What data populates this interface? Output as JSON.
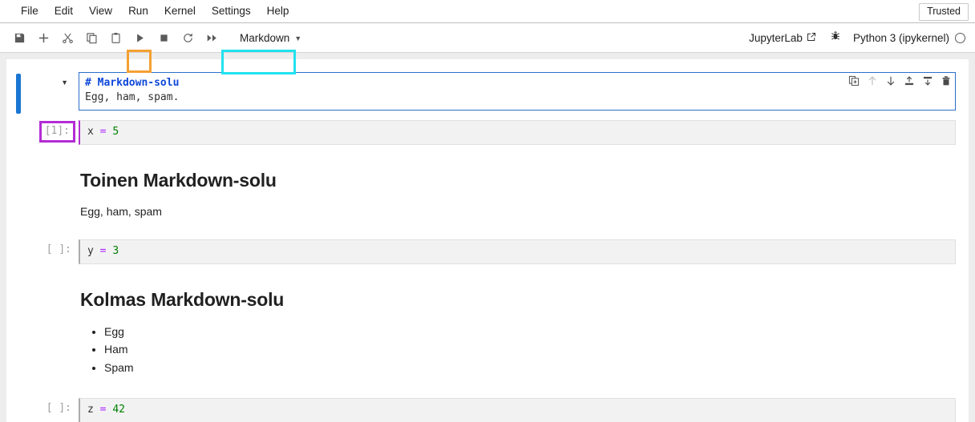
{
  "menu": {
    "items": [
      "File",
      "Edit",
      "View",
      "Run",
      "Kernel",
      "Settings",
      "Help"
    ],
    "trusted_label": "Trusted"
  },
  "toolbar": {
    "buttons": [
      {
        "name": "save-button",
        "icon": "save-icon",
        "title": "Save"
      },
      {
        "name": "insert-cell-button",
        "icon": "plus-icon",
        "title": "Insert a cell below"
      },
      {
        "name": "cut-button",
        "icon": "scissors-icon",
        "title": "Cut"
      },
      {
        "name": "copy-button",
        "icon": "copy-icon",
        "title": "Copy"
      },
      {
        "name": "paste-button",
        "icon": "clipboard-icon",
        "title": "Paste"
      },
      {
        "name": "run-button",
        "icon": "play-icon",
        "title": "Run"
      },
      {
        "name": "stop-button",
        "icon": "square-icon",
        "title": "Interrupt"
      },
      {
        "name": "restart-button",
        "icon": "refresh-icon",
        "title": "Restart"
      },
      {
        "name": "restart-run-all-button",
        "icon": "fast-forward-icon",
        "title": "Restart and run all"
      }
    ],
    "celltype_value": "Markdown",
    "celltype_options": [
      "Code",
      "Markdown",
      "Raw"
    ],
    "jupyterlab_label": "JupyterLab",
    "jupyterlab_icon": "external-link-icon",
    "debug_icon": "bug-icon",
    "kernel_label": "Python 3 (ipykernel)",
    "kernel_status_icon": "kernel-idle-circle"
  },
  "highlights": {
    "run_button_color": "#f5a033",
    "celltype_color": "#22e2ef",
    "prompt_color": "#b32cd4",
    "active_cell_color": "#1976d2"
  },
  "cell_toolbar": {
    "buttons": [
      {
        "name": "duplicate-cell-icon",
        "title": "Duplicate this cell"
      },
      {
        "name": "move-cell-up-icon",
        "title": "Move this cell up"
      },
      {
        "name": "move-cell-down-icon",
        "title": "Move this cell down"
      },
      {
        "name": "insert-cell-above-icon",
        "title": "Insert a cell above"
      },
      {
        "name": "insert-cell-below-icon",
        "title": "Insert a cell below"
      },
      {
        "name": "delete-cell-icon",
        "title": "Delete this cell"
      }
    ]
  },
  "notebook": {
    "cells": [
      {
        "type": "markdown-editing",
        "active": true,
        "collapse_icon": "chevron-down-icon",
        "source_heading": "# Markdown-solu",
        "source_body": "Egg, ham, spam."
      },
      {
        "type": "code",
        "prompt": "[1]:",
        "prompt_highlighted": true,
        "code_var": "x",
        "code_op": "=",
        "code_val": "5"
      },
      {
        "type": "markdown-rendered",
        "heading": "Toinen Markdown-solu",
        "paragraph": "Egg, ham, spam"
      },
      {
        "type": "code",
        "prompt": "[ ]:",
        "prompt_highlighted": false,
        "code_var": "y",
        "code_op": "=",
        "code_val": "3"
      },
      {
        "type": "markdown-rendered-list",
        "heading": "Kolmas Markdown-solu",
        "list_items": [
          "Egg",
          "Ham",
          "Spam"
        ]
      },
      {
        "type": "code",
        "prompt": "[ ]:",
        "prompt_highlighted": false,
        "code_var": "z",
        "code_op": "=",
        "code_val": "42"
      }
    ]
  }
}
